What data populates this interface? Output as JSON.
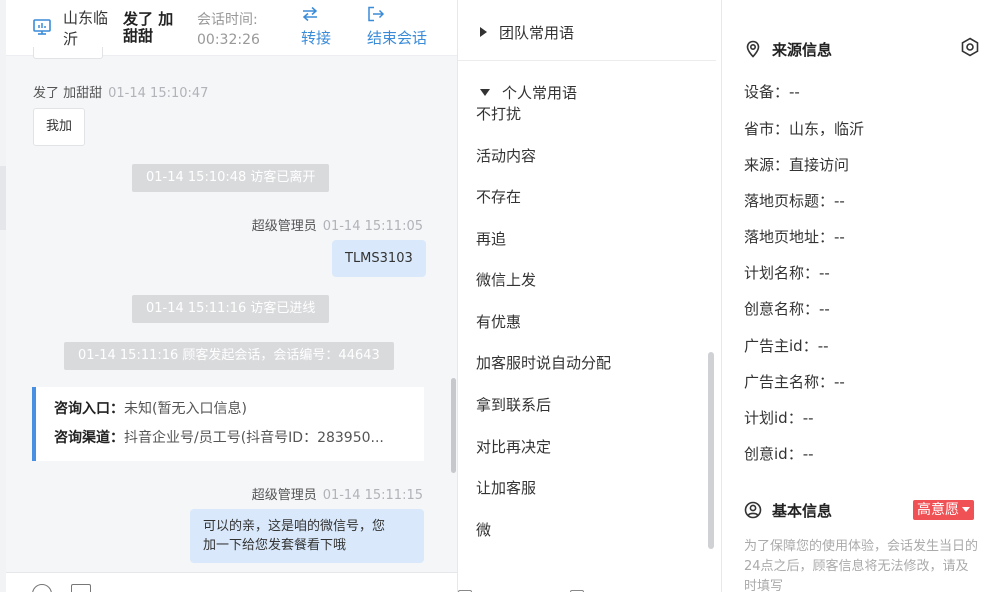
{
  "header": {
    "location": "山东临沂",
    "visitor_name": "发了 加甜甜",
    "time_label": "会话时间:",
    "time_value": "00:32:26",
    "transfer_label": "转接",
    "end_label": "结束会话"
  },
  "messages": {
    "visitor_meta_name": "发了 加甜甜",
    "visitor_meta_time": "01-14 15:10:47",
    "visitor_text": "我加",
    "sys_left": "01-14 15:10:48 访客已离开",
    "agent1_name": "超级管理员",
    "agent1_time": "01-14 15:11:05",
    "agent1_text": "TLMS3103",
    "sys_enter": "01-14 15:11:16 访客已进线",
    "sys_start": "01-14 15:11:16 顾客发起会话，会话编号：44643",
    "card_entry_key": "咨询入口：",
    "card_entry_val": "未知(暂无入口信息)",
    "card_channel_key": "咨询渠道：",
    "card_channel_val": "抖音企业号/员工号(抖音号ID：283950...",
    "agent2_name": "超级管理员",
    "agent2_time": "01-14 15:11:15",
    "agent2_line1": "可以的亲，这是咱的微信号，您",
    "agent2_line2": "加一下给您发套餐看下哦"
  },
  "quick_replies": {
    "team_group": "团队常用语",
    "personal_group": "个人常用语",
    "items": [
      "不打扰",
      "活动内容",
      "不存在",
      "再追",
      "微信上发",
      "有优惠",
      "加客服时说自动分配",
      "拿到联系后",
      "对比再决定",
      "让加客服",
      "微"
    ]
  },
  "source_info": {
    "title": "来源信息",
    "fields": [
      "设备：--",
      "省市：山东，临沂",
      "来源：直接访问",
      "落地页标题：--",
      "落地页地址：--",
      "计划名称：--",
      "创意名称：--",
      "广告主id：--",
      "广告主名称：--",
      "计划id：--",
      "创意id：--"
    ]
  },
  "basic_info": {
    "title": "基本信息",
    "intent_badge": "高意愿",
    "notice": "为了保障您的使用体验，会话发生当日的24点之后，顾客信息将无法修改，请及时填写"
  },
  "colors": {
    "accent": "#3a8bd8",
    "agent_bubble": "#d9e9fb",
    "system_bar": "#d9dadc",
    "card_border": "#4a90e2",
    "intent_badge": "#f05155"
  }
}
